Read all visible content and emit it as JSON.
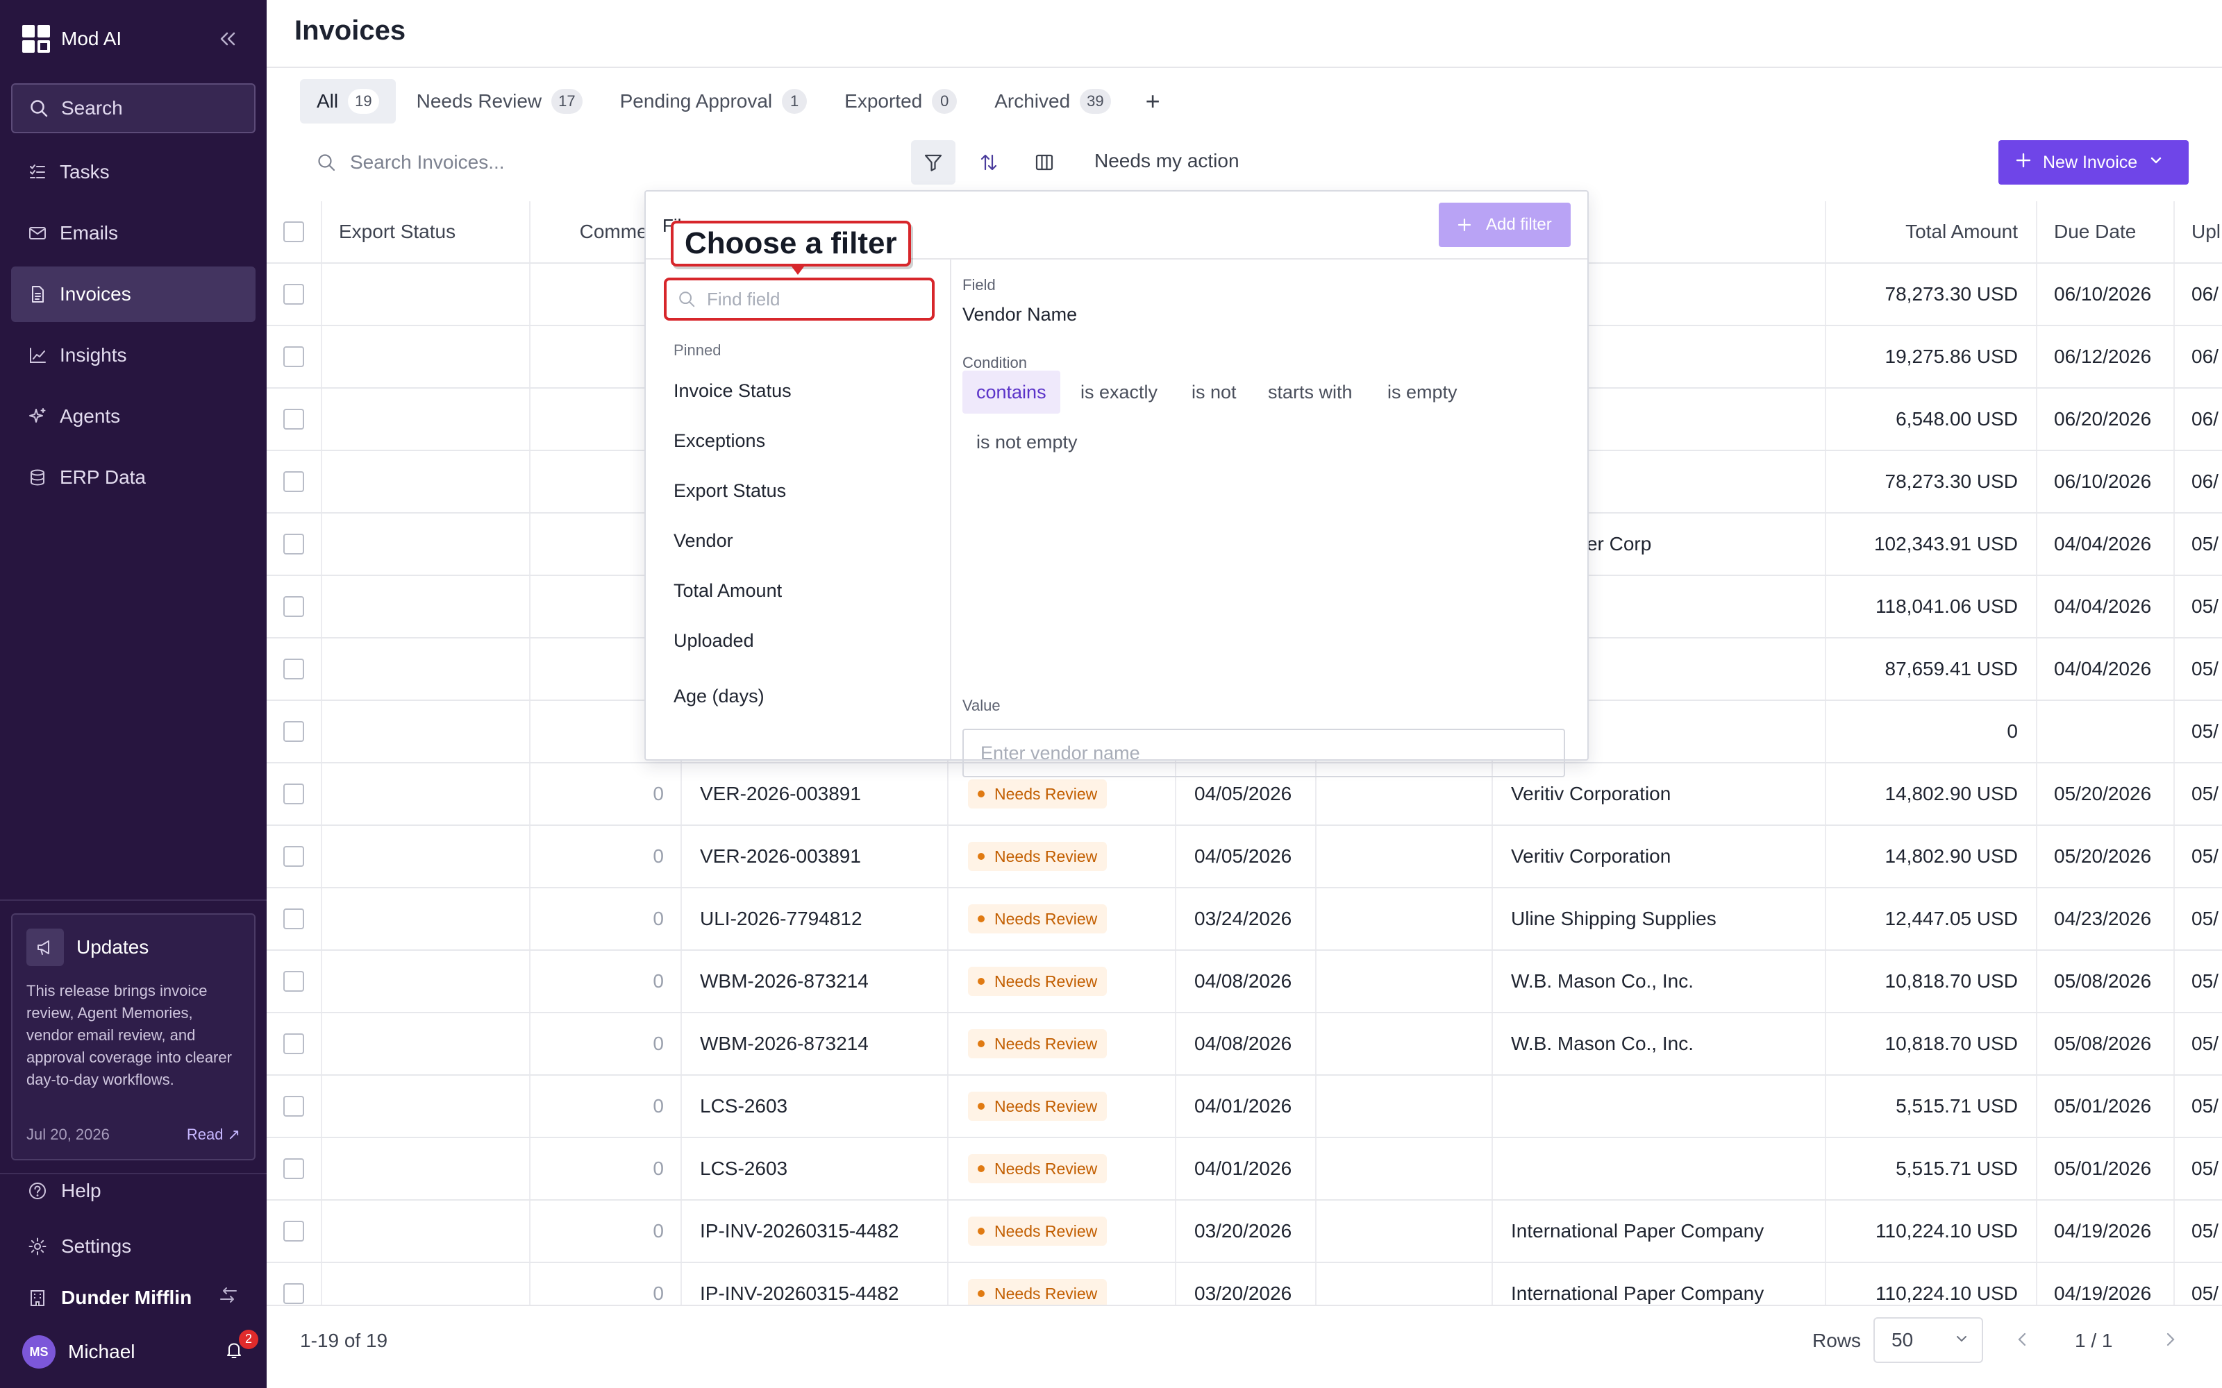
{
  "sidebar": {
    "brand": "Mod AI",
    "search_label": "Search",
    "nav": [
      {
        "label": "Tasks",
        "icon": "tasks-icon"
      },
      {
        "label": "Emails",
        "icon": "mail-icon"
      },
      {
        "label": "Invoices",
        "icon": "document-icon",
        "active": true
      },
      {
        "label": "Insights",
        "icon": "chart-icon"
      },
      {
        "label": "Agents",
        "icon": "sparkle-icon"
      },
      {
        "label": "ERP Data",
        "icon": "database-icon"
      }
    ],
    "updates": {
      "title": "Updates",
      "body": "This release brings invoice review, Agent Memories, vendor email review, and approval coverage into clearer day-to-day workflows.",
      "date": "Jul 20, 2026",
      "read_label": "Read"
    },
    "help_label": "Help",
    "settings_label": "Settings",
    "org_name": "Dunder Mifflin",
    "user_initials": "MS",
    "user_name": "Michael",
    "notification_count": "2"
  },
  "page": {
    "title": "Invoices"
  },
  "tabs": [
    {
      "label": "All",
      "count": "19",
      "active": true
    },
    {
      "label": "Needs Review",
      "count": "17"
    },
    {
      "label": "Pending Approval",
      "count": "1"
    },
    {
      "label": "Exported",
      "count": "0"
    },
    {
      "label": "Archived",
      "count": "39"
    }
  ],
  "toolbar": {
    "search_placeholder": "Search Invoices...",
    "needs_action_label": "Needs my action",
    "new_invoice_label": "New Invoice"
  },
  "table": {
    "headers": {
      "export_status": "Export Status",
      "comments": "Comment",
      "total_amount": "Total Amount",
      "due_date": "Due Date",
      "uploaded": "Upl"
    },
    "rows": [
      {
        "comments": "",
        "invoice": "",
        "status": "",
        "date": "",
        "vendor": "",
        "total": "78,273.30 USD",
        "due": "06/10/2026",
        "uploaded": "06/"
      },
      {
        "comments": "",
        "invoice": "",
        "status": "",
        "date": "",
        "vendor": "",
        "total": "19,275.86 USD",
        "due": "06/12/2026",
        "uploaded": "06/"
      },
      {
        "comments": "",
        "invoice": "",
        "status": "",
        "date": "",
        "vendor": "",
        "total": "6,548.00 USD",
        "due": "06/20/2026",
        "uploaded": "06/"
      },
      {
        "comments": "",
        "invoice": "",
        "status": "",
        "date": "",
        "vendor": "",
        "total": "78,273.30 USD",
        "due": "06/10/2026",
        "uploaded": "06/"
      },
      {
        "comments": "",
        "invoice": "",
        "status": "",
        "date": "",
        "vendor": "n Fastener Corp",
        "total": "102,343.91 USD",
        "due": "04/04/2026",
        "uploaded": "05/"
      },
      {
        "comments": "",
        "invoice": "",
        "status": "",
        "date": "",
        "vendor": "",
        "total": "118,041.06 USD",
        "due": "04/04/2026",
        "uploaded": "05/"
      },
      {
        "comments": "",
        "invoice": "",
        "status": "",
        "date": "",
        "vendor": "",
        "total": "87,659.41 USD",
        "due": "04/04/2026",
        "uploaded": "05/"
      },
      {
        "comments": "",
        "invoice": "",
        "status": "",
        "date": "",
        "vendor": "",
        "total": "0",
        "due": "",
        "uploaded": "05/"
      },
      {
        "comments": "0",
        "invoice": "VER-2026-003891",
        "status": "Needs Review",
        "date": "04/05/2026",
        "vendor": "Veritiv Corporation",
        "total": "14,802.90 USD",
        "due": "05/20/2026",
        "uploaded": "05/"
      },
      {
        "comments": "0",
        "invoice": "VER-2026-003891",
        "status": "Needs Review",
        "date": "04/05/2026",
        "vendor": "Veritiv Corporation",
        "total": "14,802.90 USD",
        "due": "05/20/2026",
        "uploaded": "05/"
      },
      {
        "comments": "0",
        "invoice": "ULI-2026-7794812",
        "status": "Needs Review",
        "date": "03/24/2026",
        "vendor": "Uline Shipping Supplies",
        "total": "12,447.05 USD",
        "due": "04/23/2026",
        "uploaded": "05/"
      },
      {
        "comments": "0",
        "invoice": "WBM-2026-873214",
        "status": "Needs Review",
        "date": "04/08/2026",
        "vendor": "W.B. Mason Co., Inc.",
        "total": "10,818.70 USD",
        "due": "05/08/2026",
        "uploaded": "05/"
      },
      {
        "comments": "0",
        "invoice": "WBM-2026-873214",
        "status": "Needs Review",
        "date": "04/08/2026",
        "vendor": "W.B. Mason Co., Inc.",
        "total": "10,818.70 USD",
        "due": "05/08/2026",
        "uploaded": "05/"
      },
      {
        "comments": "0",
        "invoice": "LCS-2603",
        "status": "Needs Review",
        "date": "04/01/2026",
        "vendor": "",
        "total": "5,515.71 USD",
        "due": "05/01/2026",
        "uploaded": "05/"
      },
      {
        "comments": "0",
        "invoice": "LCS-2603",
        "status": "Needs Review",
        "date": "04/01/2026",
        "vendor": "",
        "total": "5,515.71 USD",
        "due": "05/01/2026",
        "uploaded": "05/"
      },
      {
        "comments": "0",
        "invoice": "IP-INV-20260315-4482",
        "status": "Needs Review",
        "date": "03/20/2026",
        "vendor": "International Paper Company",
        "total": "110,224.10 USD",
        "due": "04/19/2026",
        "uploaded": "05/"
      },
      {
        "comments": "0",
        "invoice": "IP-INV-20260315-4482",
        "status": "Needs Review",
        "date": "03/20/2026",
        "vendor": "International Paper Company",
        "total": "110,224.10 USD",
        "due": "04/19/2026",
        "uploaded": "05/"
      }
    ]
  },
  "footer": {
    "range": "1-19 of 19",
    "rows_label": "Rows",
    "rows_value": "50",
    "page_indicator": "1 / 1"
  },
  "filter_popover": {
    "header_label": "Fil",
    "add_filter_label": "Add filter",
    "find_placeholder": "Find field",
    "pinned_label": "Pinned",
    "fields": [
      "Invoice Status",
      "Exceptions",
      "Export Status",
      "Vendor",
      "Total Amount",
      "Uploaded",
      "Age (days)"
    ],
    "field_label": "Field",
    "field_value": "Vendor Name",
    "condition_label": "Condition",
    "conditions": [
      {
        "label": "contains",
        "active": true
      },
      {
        "label": "is exactly"
      },
      {
        "label": "is not"
      },
      {
        "label": "starts with"
      },
      {
        "label": "is empty"
      },
      {
        "label": "is not empty"
      }
    ],
    "value_label": "Value",
    "value_placeholder": "Enter vendor name"
  },
  "annotation": {
    "callout_text": "Choose a filter",
    "color": "#d7262b"
  },
  "colors": {
    "sidebar_bg": "#27153f",
    "accent": "#6f45e8",
    "needs_review": "#c25e00"
  }
}
